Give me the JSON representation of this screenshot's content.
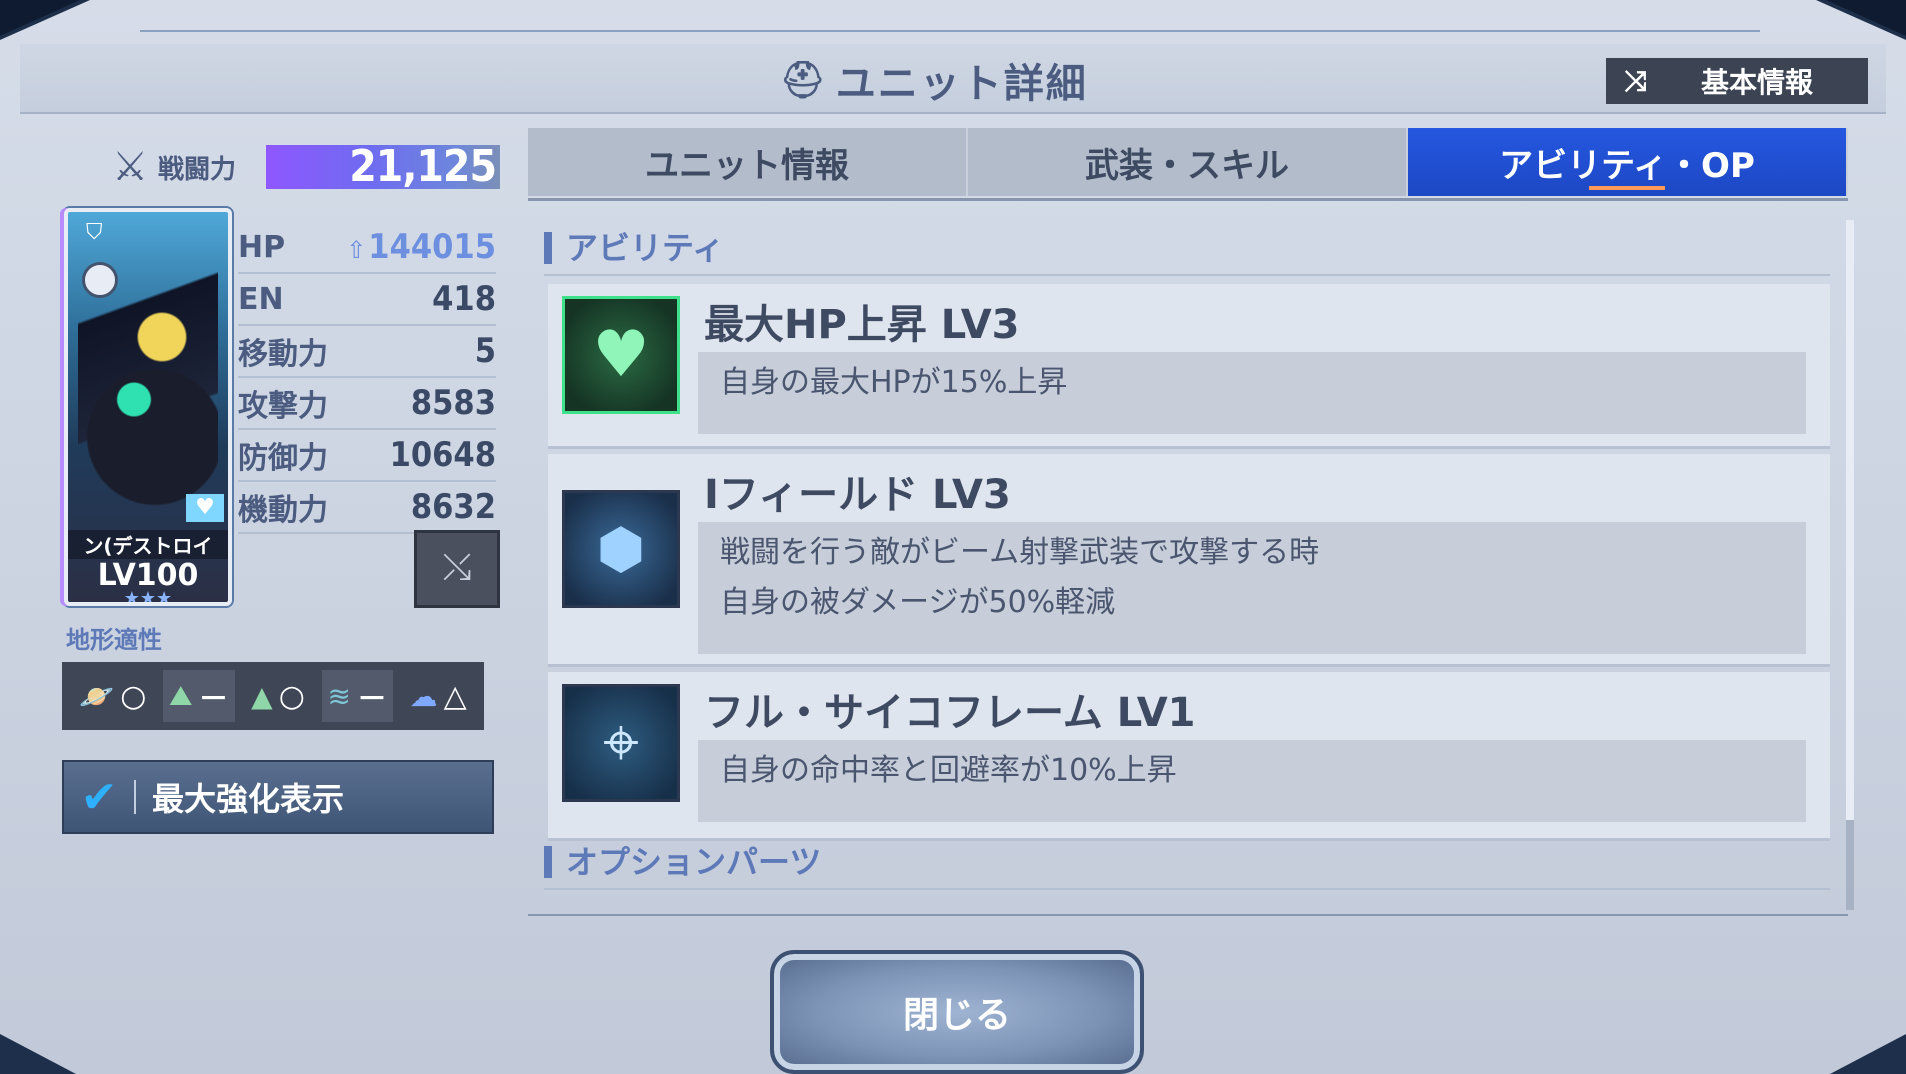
{
  "header": {
    "title": "ユニット詳細",
    "basic_info_button": "基本情報"
  },
  "unit": {
    "power_label": "戦闘力",
    "power_value": "21,125",
    "card": {
      "name": "ン(デストロイ",
      "level": "LV100",
      "stars": "★★★"
    },
    "stats": [
      {
        "label": "HP",
        "value": "144015",
        "boosted": true
      },
      {
        "label": "EN",
        "value": "418"
      },
      {
        "label": "移動力",
        "value": "5"
      },
      {
        "label": "攻撃力",
        "value": "8583"
      },
      {
        "label": "防御力",
        "value": "10648"
      },
      {
        "label": "機動力",
        "value": "8632"
      }
    ],
    "terrain_label": "地形適性",
    "terrain": [
      {
        "icon": "space-icon",
        "grade": "○"
      },
      {
        "icon": "ground-icon",
        "grade": "－"
      },
      {
        "icon": "mountain-icon",
        "grade": "○"
      },
      {
        "icon": "water-icon",
        "grade": "－"
      },
      {
        "icon": "air-icon",
        "grade": "△"
      }
    ],
    "max_enhance_label": "最大強化表示"
  },
  "tabs": [
    {
      "label": "ユニット情報",
      "active": false
    },
    {
      "label": "武装・スキル",
      "active": false
    },
    {
      "label": "アビリティ・OP",
      "active": true
    }
  ],
  "abilities_section": "アビリティ",
  "abilities": [
    {
      "name": "最大HP上昇 LV3",
      "icon": "heart-icon",
      "desc": [
        "自身の最大HPが15%上昇"
      ]
    },
    {
      "name": "Iフィールド LV3",
      "icon": "i-field-icon",
      "desc": [
        "戦闘を行う敵がビーム射撃武装で攻撃する時",
        "自身の被ダメージが50%軽減"
      ]
    },
    {
      "name": "フル・サイコフレーム LV1",
      "icon": "target-icon",
      "desc": [
        "自身の命中率と回避率が10%上昇"
      ]
    }
  ],
  "option_parts_section": "オプションパーツ",
  "close_button": "閉じる",
  "colors": {
    "active_tab": "#2557e0",
    "accent_blue": "#5e79b8",
    "power_bar": "#8f57ff"
  }
}
